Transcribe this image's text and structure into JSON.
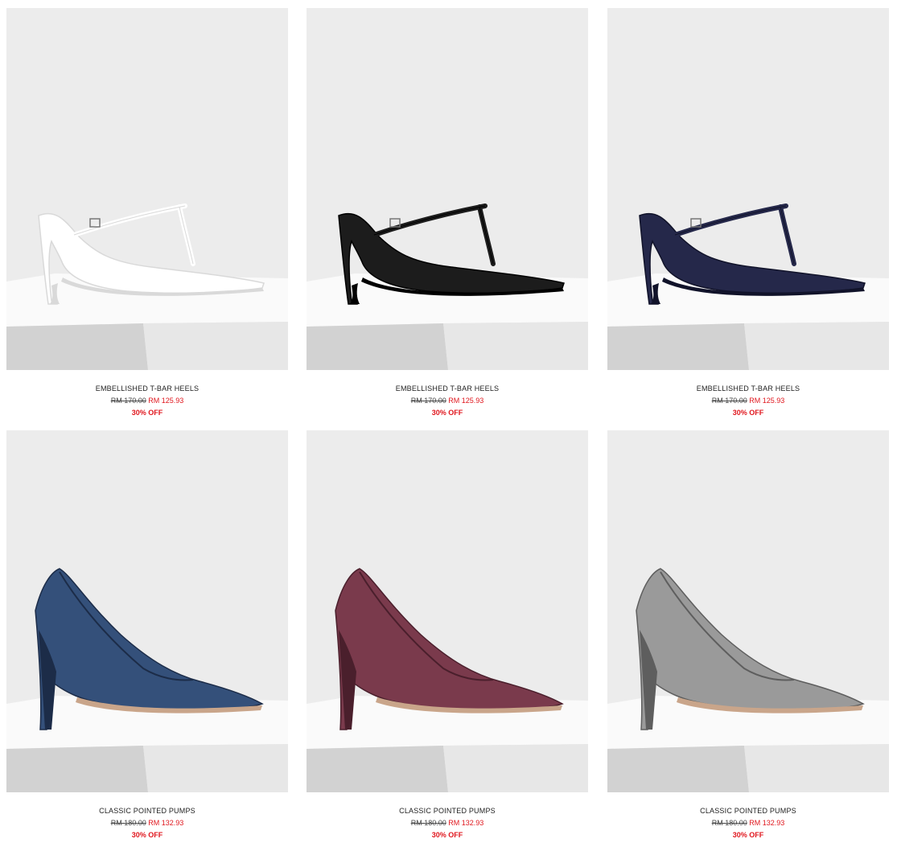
{
  "theme": {
    "sale_color": "#e0161d",
    "studio_bg": "#ececec",
    "plinth_top": "#fafafa",
    "plinth_front": "#d2d2d2"
  },
  "products": [
    {
      "name": "EMBELLISHED T-BAR HEELS",
      "original_price": "RM 170.00",
      "sale_price": "RM 125.93",
      "discount": "30% OFF",
      "image_alt": "white-t-bar-kitten-heel",
      "shoe_color": "#ffffff",
      "shoe_shadow": "#d9d9d9",
      "style": "tbar"
    },
    {
      "name": "EMBELLISHED T-BAR HEELS",
      "original_price": "RM 170.00",
      "sale_price": "RM 125.93",
      "discount": "30% OFF",
      "image_alt": "black-t-bar-kitten-heel",
      "shoe_color": "#1c1c1c",
      "shoe_shadow": "#000000",
      "style": "tbar"
    },
    {
      "name": "EMBELLISHED T-BAR HEELS",
      "original_price": "RM 170.00",
      "sale_price": "RM 125.93",
      "discount": "30% OFF",
      "image_alt": "navy-t-bar-kitten-heel",
      "shoe_color": "#25284a",
      "shoe_shadow": "#11132a",
      "style": "tbar"
    },
    {
      "name": "CLASSIC POINTED PUMPS",
      "original_price": "RM 180.00",
      "sale_price": "RM 132.93",
      "discount": "30% OFF",
      "image_alt": "blue-metallic-pointed-pump",
      "shoe_color": "#34507a",
      "shoe_shadow": "#1c2c48",
      "style": "pump"
    },
    {
      "name": "CLASSIC POINTED PUMPS",
      "original_price": "RM 180.00",
      "sale_price": "RM 132.93",
      "discount": "30% OFF",
      "image_alt": "burgundy-metallic-pointed-pump",
      "shoe_color": "#7a3a4c",
      "shoe_shadow": "#4a1f2c",
      "style": "pump"
    },
    {
      "name": "CLASSIC POINTED PUMPS",
      "original_price": "RM 180.00",
      "sale_price": "RM 132.93",
      "discount": "30% OFF",
      "image_alt": "silver-metallic-pointed-pump",
      "shoe_color": "#9a9a9a",
      "shoe_shadow": "#5e5e5e",
      "style": "pump"
    }
  ]
}
